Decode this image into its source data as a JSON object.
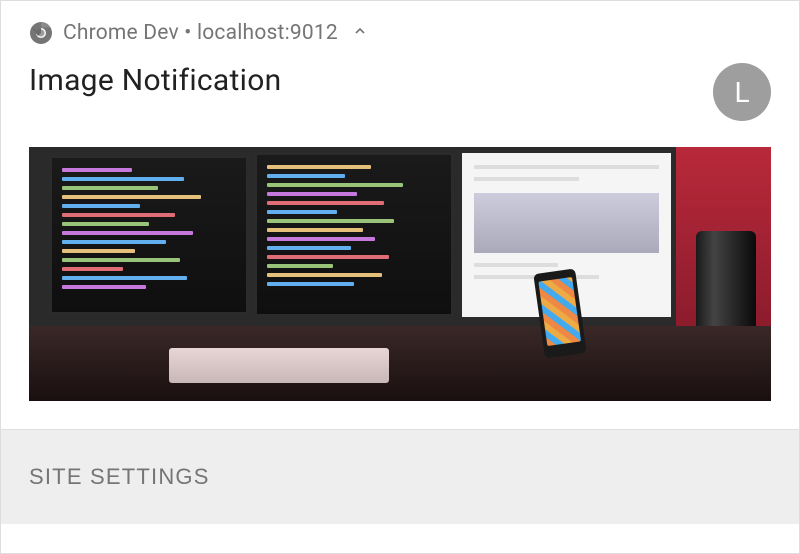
{
  "header": {
    "app_name": "Chrome Dev",
    "separator": " • ",
    "origin": "localhost:9012",
    "icon": "chrome-icon",
    "chevron": "chevron-up-icon"
  },
  "notification": {
    "title": "Image Notification",
    "avatar_letter": "L",
    "image_alt": "Developer desk with multiple monitors showing code"
  },
  "actions": {
    "site_settings_label": "SITE SETTINGS"
  }
}
